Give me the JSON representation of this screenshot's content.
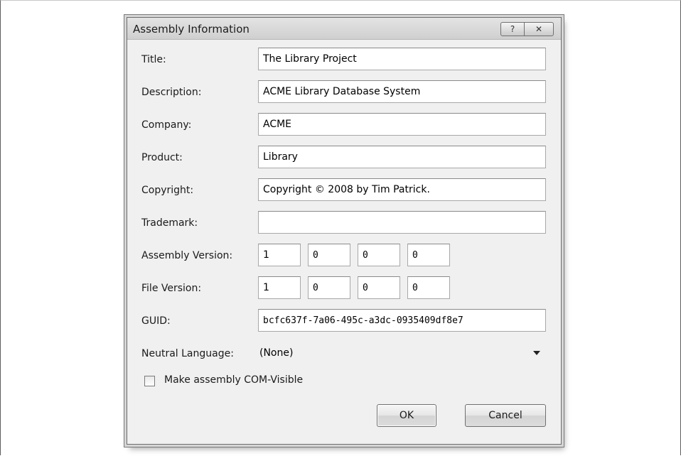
{
  "dialog": {
    "title": "Assembly Information",
    "help_button": "?",
    "close_button": "✕"
  },
  "fields": {
    "title": {
      "label": "Title:",
      "value": "The Library Project"
    },
    "description": {
      "label": "Description:",
      "value": "ACME Library Database System"
    },
    "company": {
      "label": "Company:",
      "value": "ACME"
    },
    "product": {
      "label": "Product:",
      "value": "Library"
    },
    "copyright": {
      "label": "Copyright:",
      "value": "Copyright © 2008 by Tim Patrick."
    },
    "trademark": {
      "label": "Trademark:",
      "value": ""
    },
    "assembly_version": {
      "label": "Assembly Version:",
      "parts": [
        "1",
        "0",
        "0",
        "0"
      ]
    },
    "file_version": {
      "label": "File Version:",
      "parts": [
        "1",
        "0",
        "0",
        "0"
      ]
    },
    "guid": {
      "label": "GUID:",
      "value": "bcfc637f-7a06-495c-a3dc-0935409df8e7"
    },
    "neutral_language": {
      "label": "Neutral Language:",
      "selected": "(None)"
    }
  },
  "com_visible": {
    "label": "Make assembly COM-Visible",
    "checked": false
  },
  "buttons": {
    "ok": "OK",
    "cancel": "Cancel"
  }
}
